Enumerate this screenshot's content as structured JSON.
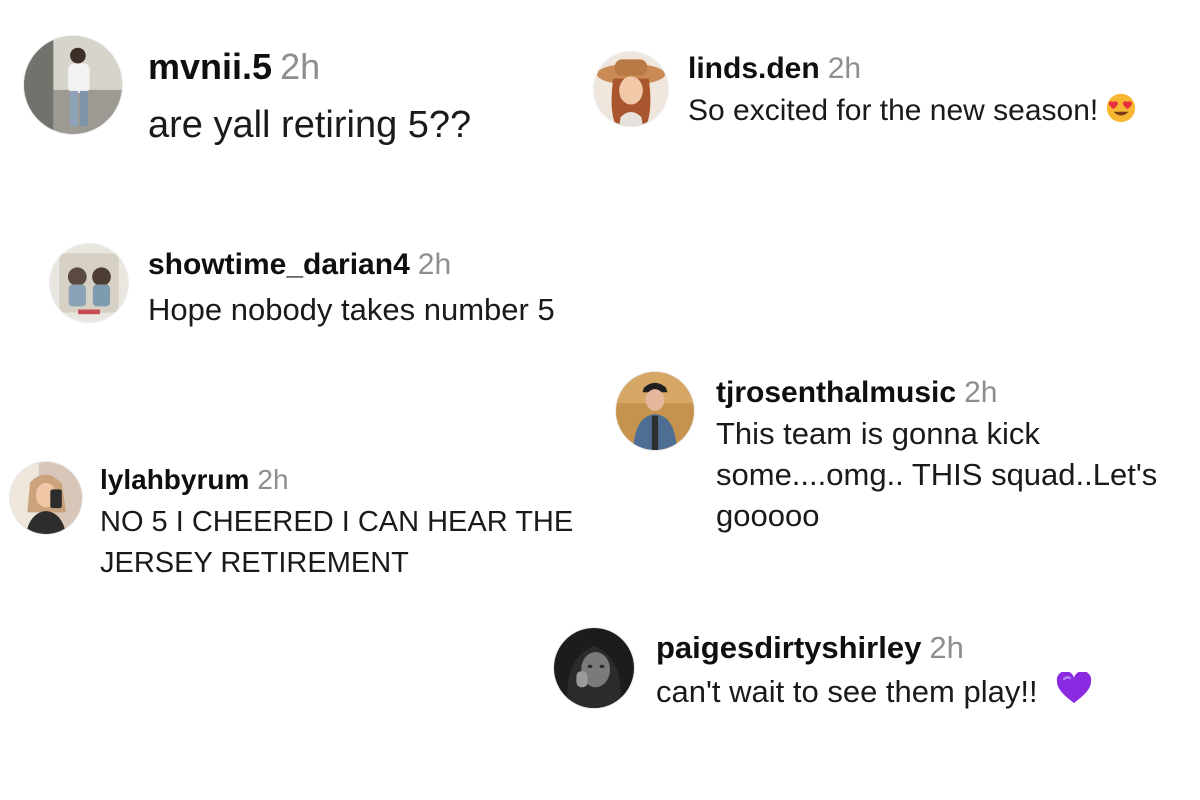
{
  "comments": [
    {
      "username": "mvnii.5",
      "time": "2h",
      "text": "are yall retiring 5??",
      "emoji": ""
    },
    {
      "username": "linds.den",
      "time": "2h",
      "text": "So excited for the new season!",
      "emoji": "heart-eyes-emoji"
    },
    {
      "username": "showtime_darian4",
      "time": "2h",
      "text": "Hope nobody takes number 5",
      "emoji": ""
    },
    {
      "username": "tjrosenthalmusic",
      "time": "2h",
      "text": "This team is gonna kick some....omg.. THIS squad..Let's gooooo",
      "emoji": ""
    },
    {
      "username": "lylahbyrum",
      "time": "2h",
      "text": "NO 5 I CHEERED I CAN HEAR THE JERSEY RETIREMENT",
      "emoji": ""
    },
    {
      "username": "paigesdirtyshirley",
      "time": "2h",
      "text": "can't wait to see them play!!",
      "emoji": "purple-heart-emoji"
    }
  ],
  "colors": {
    "username": "#0f0f0f",
    "timestamp": "#8e8e8e",
    "text": "#1a1a1a",
    "emoji_face": "#f7b733",
    "emoji_heart_red": "#e8303a",
    "emoji_heart_purple": "#8a2be2"
  }
}
